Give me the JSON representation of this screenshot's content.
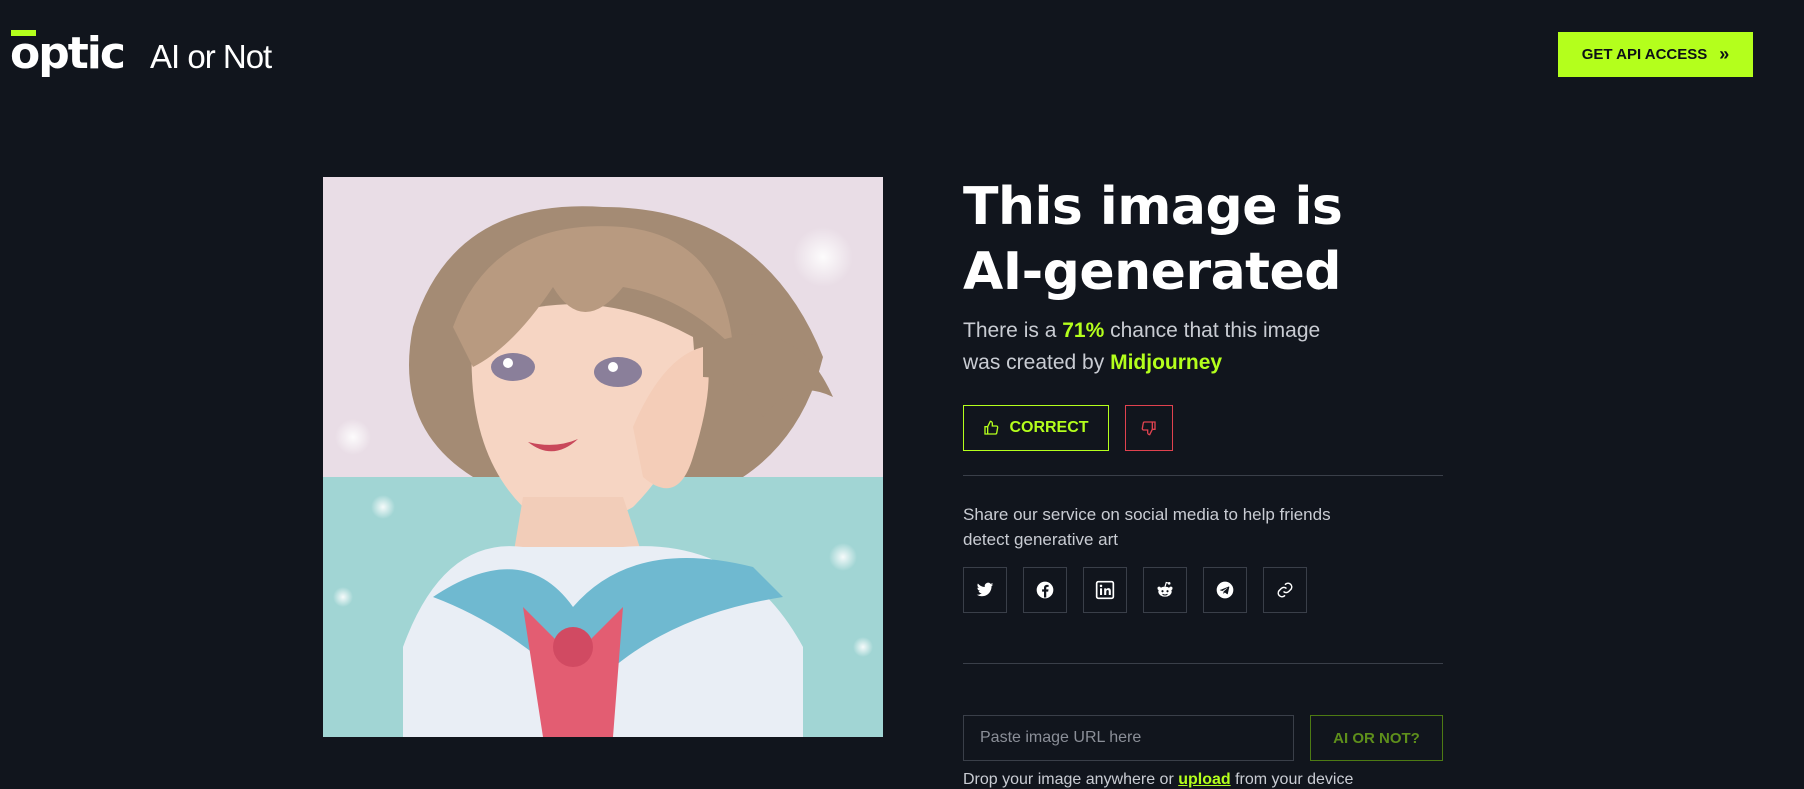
{
  "header": {
    "logo_text": "optic",
    "app_name": "AI or Not",
    "api_button_label": "GET API ACCESS",
    "api_button_icon": "double-chevron-right-icon"
  },
  "result": {
    "title": "This image is AI-generated",
    "desc_prefix": "There is a ",
    "percent": "71%",
    "desc_middle": " chance that this image was created by ",
    "generator": "Midjourney",
    "correct_label": "CORRECT",
    "correct_icon": "thumbs-up-icon",
    "wrong_icon": "thumbs-down-icon"
  },
  "share": {
    "text": "Share our service on social media to help friends detect generative art",
    "icons": [
      "twitter-icon",
      "facebook-icon",
      "linkedin-icon",
      "reddit-icon",
      "telegram-icon",
      "link-icon"
    ]
  },
  "check": {
    "placeholder": "Paste image URL here",
    "button_label": "AI OR NOT?",
    "drop_prefix": "Drop your image anywhere or ",
    "upload_link": "upload",
    "drop_suffix": " from your device"
  },
  "colors": {
    "background": "#11151d",
    "accent": "#b4ff1c",
    "danger": "#e0424f"
  }
}
